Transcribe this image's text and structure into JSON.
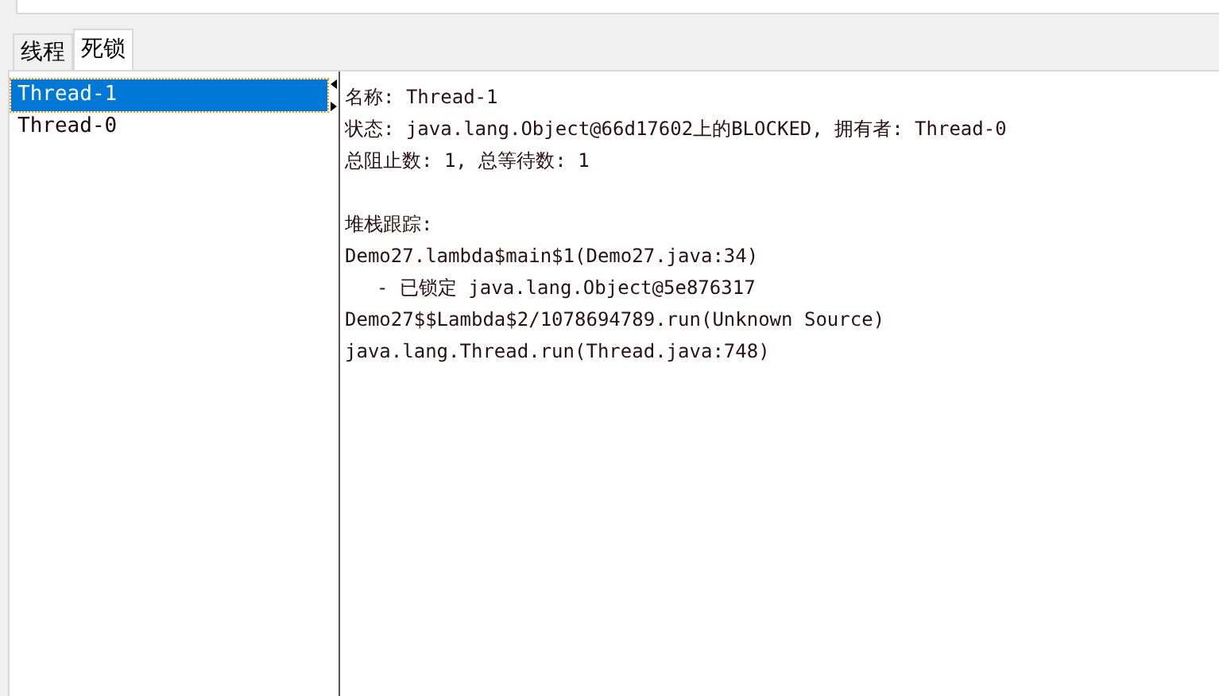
{
  "tabs": [
    {
      "label": "线程",
      "selected": false
    },
    {
      "label": "死锁",
      "selected": true
    }
  ],
  "threads": [
    {
      "label": "Thread-1",
      "selected": true
    },
    {
      "label": "Thread-0",
      "selected": false
    }
  ],
  "details": {
    "info": [
      "名称: Thread-1",
      "状态: java.lang.Object@66d17602上的BLOCKED, 拥有者: Thread-0",
      "总阻止数: 1, 总等待数: 1"
    ],
    "stack_heading": "堆栈跟踪:",
    "stack": [
      {
        "kind": "frame",
        "text": "Demo27.lambda$main$1(Demo27.java:34)"
      },
      {
        "kind": "lock",
        "text": "- 已锁定 java.lang.Object@5e876317"
      },
      {
        "kind": "frame",
        "text": "Demo27$$Lambda$2/1078694789.run(Unknown Source)"
      },
      {
        "kind": "frame",
        "text": "java.lang.Thread.run(Thread.java:748)"
      }
    ]
  }
}
